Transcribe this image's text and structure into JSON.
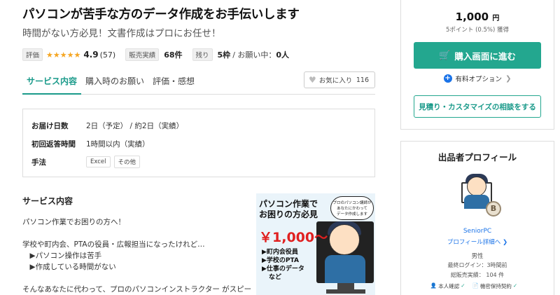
{
  "header": {
    "title": "パソコンが苦手な方のデータ作成をお手伝いします",
    "subtitle": "時間がない方必見！文書作成はプロにお任せ！"
  },
  "stats": {
    "rating_tag": "評価",
    "stars": "★★★★★",
    "rating": "4.9",
    "review_count": "(57)",
    "sales_tag": "販売実績",
    "sales_value": "68件",
    "remain_tag": "残り",
    "remain_value": "5枠",
    "request_text": "/ お願い中：",
    "request_value": "0人"
  },
  "tabs": [
    {
      "label": "サービス内容"
    },
    {
      "label": "購入時のお願い"
    },
    {
      "label": "評価・感想"
    }
  ],
  "favorite": {
    "label": "お気に入り",
    "count": "116"
  },
  "info": {
    "delivery_label": "お届け日数",
    "delivery_value": "2日（予定） / 約2日（実績）",
    "response_label": "初回返答時間",
    "response_value": "1時間以内（実績）",
    "method_label": "手法",
    "method_chips": [
      "Excel",
      "その他"
    ]
  },
  "description": {
    "heading": "サービス内容",
    "lines": [
      "パソコン作業でお困りの方へ！",
      "",
      "学校や町内会、PTAの役員・広報担当になったけれど…",
      "　▶パソコン操作は苦手",
      "　▶作成している時間がない",
      "",
      "そんなあなたに代わって、プロのパソコンインストラクター がスピー"
    ]
  },
  "thumbnail": {
    "headline_1": "パソコン作業で",
    "headline_2": "お困りの方必見",
    "bubble_1": "プロのパソコン講師が",
    "bubble_2": "あなたにかわって",
    "bubble_3": "データ作成します",
    "price": "￥1,000～",
    "bullet_1": "▶町内会役員",
    "bullet_2": "▶学校のPTA",
    "bullet_3": "▶仕事のデータ",
    "bullet_4": "など"
  },
  "purchase": {
    "price": "1,000",
    "yen": "円",
    "points": "5ポイント (0.5%) 獲得",
    "buy_label": "購入画面に進む",
    "option_label": "有料オプション",
    "quote_label": "見積り・カスタマイズの相談をする"
  },
  "profile": {
    "title": "出品者プロフィール",
    "badge": "B",
    "name": "SeniorPC",
    "detail_link": "プロフィール詳細へ ❯",
    "gender": "男性",
    "last_login": "最終ログイン：3時間前",
    "total_sales": "総販売実績： 104 件",
    "identity": "本人確認",
    "nda": "機密保持契約",
    "check": "✓"
  },
  "colors": {
    "accent": "#23a78f",
    "link": "#1a73e8",
    "price_red": "#e02020",
    "star": "#f5a623"
  }
}
